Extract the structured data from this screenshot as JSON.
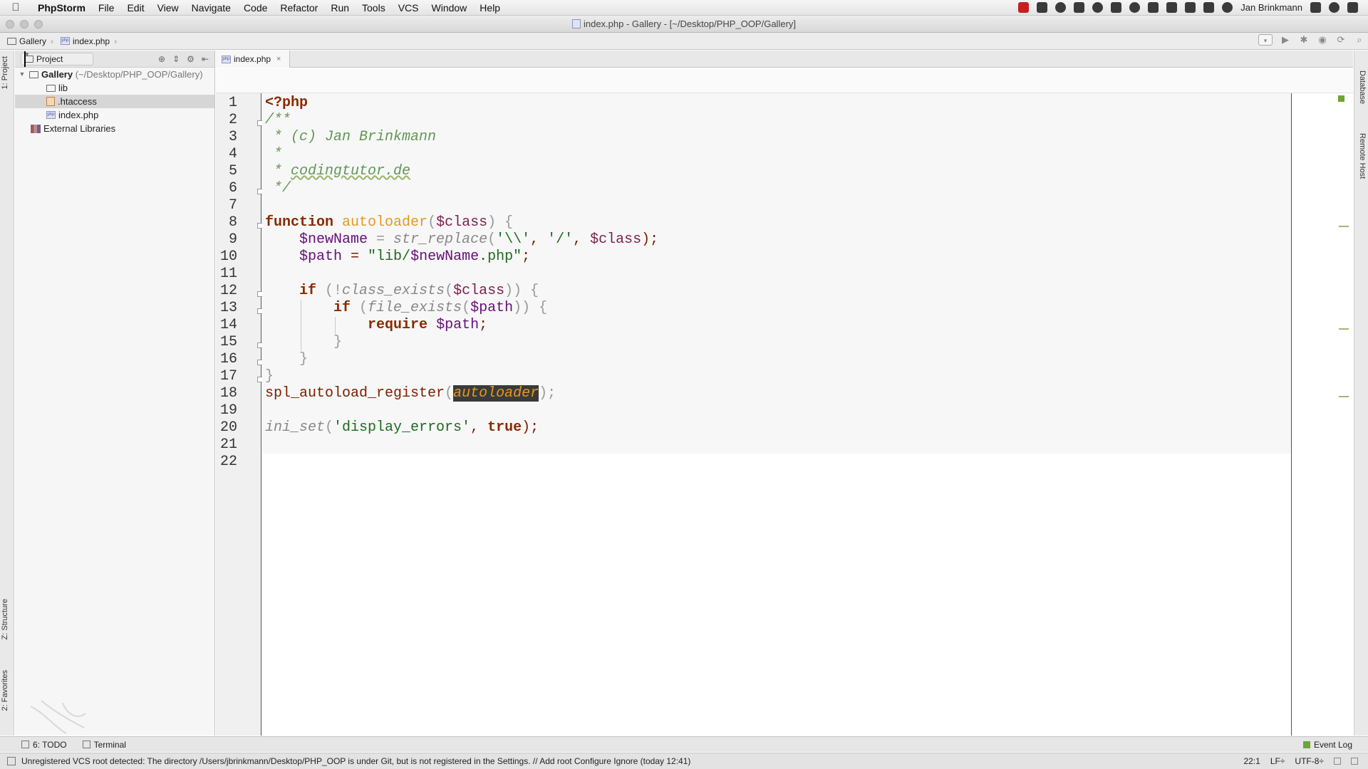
{
  "menubar": {
    "app_name": "PhpStorm",
    "items": [
      "File",
      "Edit",
      "View",
      "Navigate",
      "Code",
      "Refactor",
      "Run",
      "Tools",
      "VCS",
      "Window",
      "Help"
    ],
    "user": "Jan Brinkmann"
  },
  "window": {
    "title": "index.php - Gallery - [~/Desktop/PHP_OOP/Gallery]"
  },
  "breadcrumb": {
    "project": "Gallery",
    "file": "index.php"
  },
  "side_tabs": {
    "project": "1: Project",
    "structure": "Z: Structure",
    "favorites": "2: Favorites",
    "database": "Database",
    "remote_host": "Remote Host"
  },
  "project_panel": {
    "view_selector": "Project",
    "tree": [
      {
        "label": "Gallery",
        "suffix": "(~/Desktop/PHP_OOP/Gallery)",
        "icon": "folder-icon",
        "depth": 0
      },
      {
        "label": "lib",
        "suffix": "",
        "icon": "folder-icon",
        "depth": 1
      },
      {
        "label": ".htaccess",
        "suffix": "",
        "icon": "htaccess-file-icon",
        "depth": 1,
        "selected": true
      },
      {
        "label": "index.php",
        "suffix": "",
        "icon": "php-file-icon",
        "depth": 1
      },
      {
        "label": "External Libraries",
        "suffix": "",
        "icon": "library-icon",
        "depth": 0
      }
    ]
  },
  "editor": {
    "tab_label": "index.php",
    "line_numbers": [
      "1",
      "2",
      "3",
      "4",
      "5",
      "6",
      "7",
      "8",
      "9",
      "10",
      "11",
      "12",
      "13",
      "14",
      "15",
      "16",
      "17",
      "18",
      "19",
      "20",
      "21",
      "22"
    ],
    "code": {
      "l1_open": "<?php",
      "l2": "/**",
      "l3": " * (c) Jan Brinkmann",
      "l4": " *",
      "l5_star": " * ",
      "l5_link": "codingtutor.de",
      "l6": " */",
      "l8_kw": "function",
      "l8_name": "autoloader",
      "l8_open": "(",
      "l8_var": "$class",
      "l8_close": ") {",
      "l9_var": "$newName",
      "l9_eq": " = ",
      "l9_fn": "str_replace",
      "l9_open": "(",
      "l9_s1": "'\\\\'",
      "l9_c1": ", ",
      "l9_s2": "'/'",
      "l9_c2": ", ",
      "l9_var2": "$class",
      "l9_end": ");",
      "l10_var": "$path",
      "l10_eq": " = ",
      "l10_s1": "\"lib/",
      "l10_var2": "$newName",
      "l10_s2": ".php\"",
      "l10_end": ";",
      "l12_kw": "if",
      "l12_open": " (!",
      "l12_fn": "class_exists",
      "l12_p": "(",
      "l12_var": "$class",
      "l12_close": ")) {",
      "l13_kw": "if",
      "l13_open": " (",
      "l13_fn": "file_exists",
      "l13_p": "(",
      "l13_var": "$path",
      "l13_close": ")) {",
      "l14_kw": "require",
      "l14_var": "$path",
      "l14_end": ";",
      "l15": "}",
      "l16": "}",
      "l17": "}",
      "l18_fn": "spl_autoload_register",
      "l18_open": "(",
      "l18_arg": "autoloader",
      "l18_close": ");",
      "l20_fn": "ini_set",
      "l20_open": "(",
      "l20_s": "'display_errors'",
      "l20_c": ", ",
      "l20_kw": "true",
      "l20_end": ");"
    }
  },
  "bottom_tools": {
    "todo": "6: TODO",
    "terminal": "Terminal",
    "event_log": "Event Log"
  },
  "statusbar": {
    "message": "Unregistered VCS root detected: The directory /Users/jbrinkmann/Desktop/PHP_OOP is under Git, but is not registered in the Settings. // Add root  Configure  Ignore (today 12:41)",
    "position": "22:1",
    "line_ending": "LF÷",
    "encoding": "UTF-8÷"
  },
  "colors": {
    "keyword": "#1e1e80",
    "comment": "#629755",
    "function_decl": "#e39a20",
    "variable": "#660e7a",
    "string": "#1f6b1f"
  }
}
